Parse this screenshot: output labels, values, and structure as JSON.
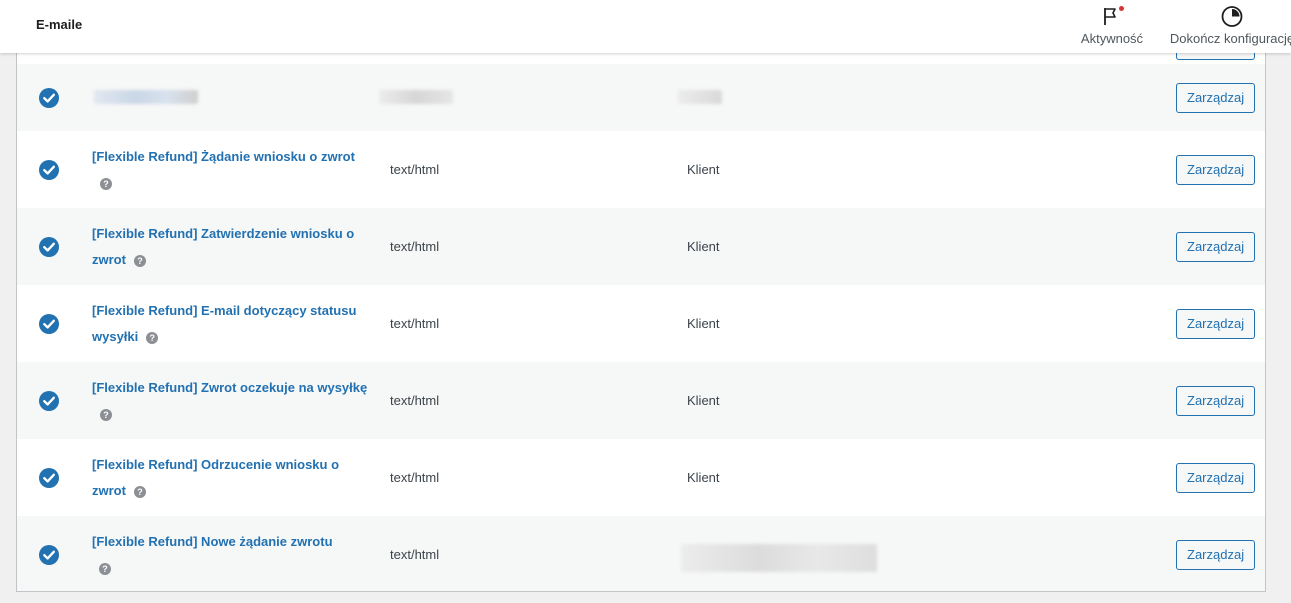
{
  "header": {
    "title": "E-maile",
    "activity_label": "Aktywność",
    "finish_setup_label": "Dokończ konfigurację"
  },
  "colors": {
    "accent": "#2271b1",
    "notification": "#d63638"
  },
  "icons": {
    "activity": "flag-icon",
    "finish_setup": "progress-circle-icon",
    "enabled": "check-circle-icon",
    "help": "help-icon"
  },
  "manage_label": "Zarządzaj",
  "emails": [
    {
      "title": "",
      "content_type": "",
      "recipient": "",
      "enabled": true
    },
    {
      "title": "[Flexible Refund] Żądanie wniosku o zwrot",
      "content_type": "text/html",
      "recipient": "Klient",
      "enabled": true
    },
    {
      "title": "[Flexible Refund] Zatwierdzenie wniosku o zwrot",
      "content_type": "text/html",
      "recipient": "Klient",
      "enabled": true
    },
    {
      "title": "[Flexible Refund] E-mail dotyczący statusu wysyłki",
      "content_type": "text/html",
      "recipient": "Klient",
      "enabled": true
    },
    {
      "title": "[Flexible Refund] Zwrot oczekuje na wysyłkę",
      "content_type": "text/html",
      "recipient": "Klient",
      "enabled": true
    },
    {
      "title": "[Flexible Refund] Odrzucenie wniosku o zwrot",
      "content_type": "text/html",
      "recipient": "Klient",
      "enabled": true
    },
    {
      "title": "[Flexible Refund] Nowe żądanie zwrotu",
      "content_type": "text/html",
      "recipient": "",
      "enabled": true
    }
  ]
}
